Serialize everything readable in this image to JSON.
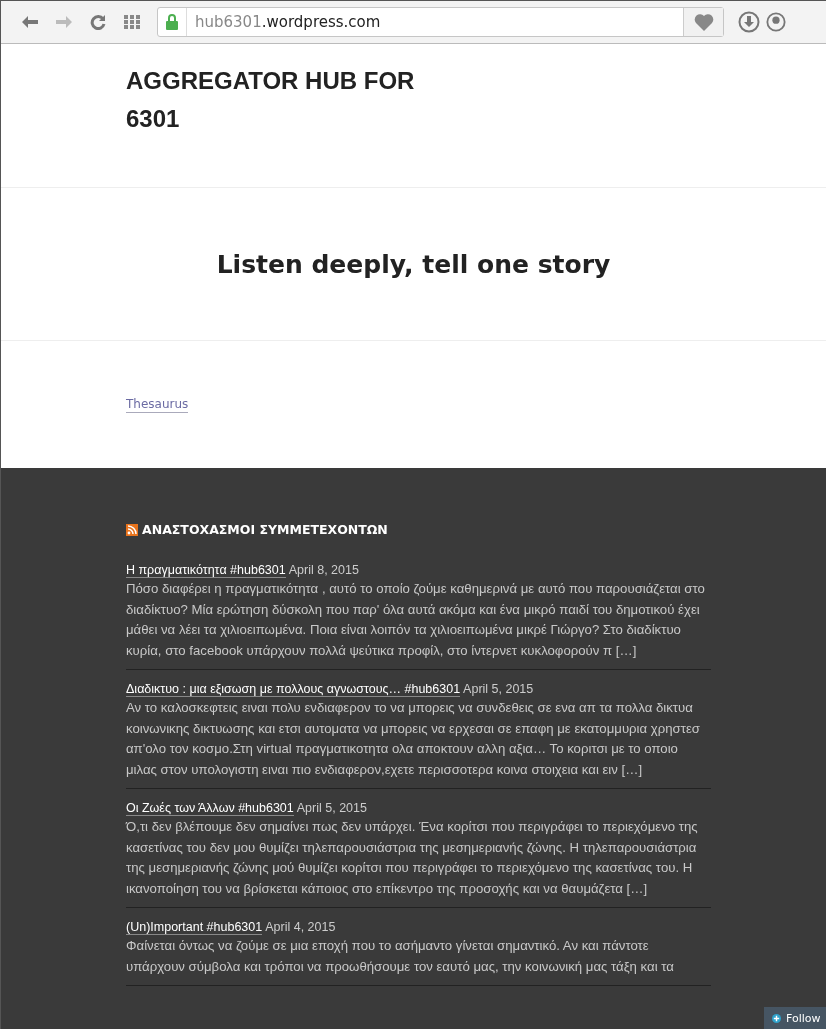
{
  "browser": {
    "url_host": "hub6301",
    "url_domain": ".wordpress.com",
    "secure": true
  },
  "site": {
    "title": "AGGREGATOR HUB FOR 6301",
    "tagline": "Listen deeply, tell one story",
    "menu": [
      {
        "label": "Thesaurus"
      }
    ]
  },
  "widget": {
    "title": "ΑΝΑΣΤΟΧΑΣΜΟΙ ΣΥΜΜΕΤΕΧΟΝΤΩΝ",
    "posts": [
      {
        "title": "Η πραγματικότητα #hub6301",
        "date": "April 8, 2015",
        "excerpt": "Πόσο διαφέρει η πραγματικότητα , αυτό το οποίο ζούμε καθημερινά με αυτό που παρουσιάζεται στο διαδίκτυο? Μία ερώτηση δύσκολη που παρ' όλα αυτά ακόμα και ένα μικρό παιδί του δημοτικού έχει μάθει να λέει τα χιλιοειπωμένα. Ποια είναι λοιπόν τα χιλιοειπωμένα μικρέ Γιώργο? Στο διαδίκτυο κυρία, στο facebook υπάρχουν πολλά ψεύτικα προφίλ, στο ίντερνετ κυκλοφορούν π […]"
      },
      {
        "title": "Διαδικτυο : μια εξισωση με πολλους αγνωστους…  #hub6301",
        "date": "April 5, 2015",
        "excerpt": "Αν το καλοσκεφτεις ειναι πολυ ενδιαφερον το να μπορεις να συνδεθεις σε ενα απ τα πολλα δικτυα κοινωνικης δικτυωσης και ετσι αυτοματα να μπορεις να ερχεσαι σε επαφη με εκατομμυρια χρηστεσ απ'ολο τον κοσμο.Στη virtual πραγματικοτητα ολα αποκτουν αλλη αξια… Το κοριτσι με το οποιο μιλας στον υπολογιστη ειναι πιο ενδιαφερον,εχετε περισσοτερα κοινα στοιχεια και ειν […]"
      },
      {
        "title": "Οι Ζωές των Άλλων #hub6301",
        "date": "April 5, 2015",
        "excerpt": "Ό,τι δεν βλέπουμε δεν σημαίνει πως δεν υπάρχει. Ένα κορίτσι που περιγράφει το περιεχόμενο της κασετίνας του δεν μου θυμίζει τηλεπαρουσιάστρια της μεσημεριανής ζώνης. Η τηλεπαρουσιάστρια της μεσημεριανής ζώνης μού θυμίζει κορίτσι που περιγράφει το περιεχόμενο της κασετίνας του. Η ικανοποίηση του να βρίσκεται κάποιος στο επίκεντρο της προσοχής και να θαυμάζετα […]"
      },
      {
        "title": "(Un)Important #hub6301",
        "date": "April 4, 2015",
        "excerpt": "Φαίνεται όντως να ζούμε σε μια εποχή που το ασήμαντο γίνεται σημαντικό. Αν και πάντοτε υπάρχουν σύμβολα και τρόποι να προωθήσουμε τον εαυτό μας, την κοινωνική μας τάξη και τα"
      }
    ]
  },
  "follow_button": {
    "label": "Follow"
  }
}
